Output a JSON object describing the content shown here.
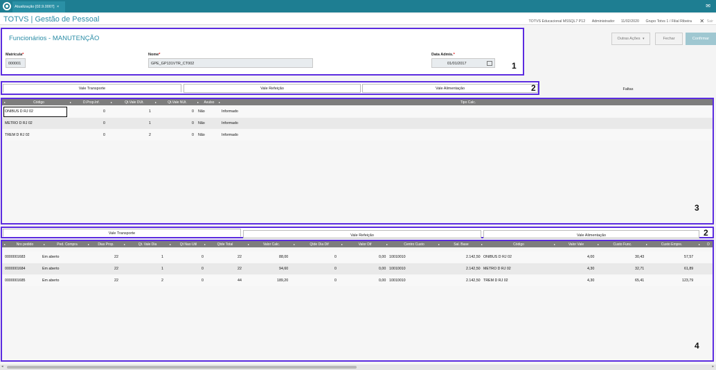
{
  "window": {
    "tab_label": "Atualização [02.9.0007]",
    "tab_close": "×",
    "app_title": "TOTVS | Gestão de Pessoal",
    "environment": "TOTVS Educacional MSSQL7 P12",
    "user": "Administrador",
    "date": "11/02/2020",
    "branch": "Grupo Totvs 1 / Filial Ribeira",
    "close_label": "✕",
    "extra": "Sair"
  },
  "form": {
    "title": "Funcionários - MANUTENÇÃO",
    "matricula_label": "Matrícula",
    "matricula_value": "000001",
    "nome_label": "Nome",
    "nome_value": "GPE_GP131VTR_CT002",
    "data_label": "Data Admis.",
    "data_value": "01/01/2017",
    "required_mark": "*"
  },
  "actions": {
    "outras": "Outras Ações",
    "fechar": "Fechar",
    "confirmar": "Confirmar"
  },
  "markers": {
    "m1": "1",
    "m2": "2",
    "m3": "3",
    "m2b": "2",
    "m4": "4"
  },
  "tabs_top": [
    "Vale Transporte",
    "Vale Refeição",
    "Vale Alimentação",
    "Faltas"
  ],
  "tabs_bottom": [
    "Vale Transporte",
    "Vale Refeição",
    "Vale Alimentação"
  ],
  "grid_top": {
    "headers": [
      "Código",
      "D.Prop.Inf.",
      "Qt.Vale DUt.",
      "Qt.Vale NUt.",
      "Avulso",
      "Tipo Calc."
    ],
    "rows": [
      [
        "ONIBUS D RJ 02",
        "0",
        "1",
        "0",
        "Não",
        "Informado"
      ],
      [
        "METRO D RJ 02",
        "0",
        "1",
        "0",
        "Não",
        "Informado"
      ],
      [
        "TREM D RJ 02",
        "0",
        "2",
        "0",
        "Não",
        "Informado"
      ]
    ]
  },
  "grid_bottom": {
    "headers": [
      "Nro pedido",
      "Ped. Compra",
      "Dias Prop.",
      "Qt. Vale Dia",
      "Qt Nao Util",
      "Qtde Total",
      "Valor Calc.",
      "Qtde Dia Dif",
      "Valor Dif",
      "Centro Custo",
      "Sal. Base",
      "Código",
      "Valor Vale",
      "Custo Func.",
      "Custo Empre.",
      "D"
    ],
    "rows": [
      [
        "0000001683",
        "Em aberto",
        "22",
        "1",
        "0",
        "22",
        "88,00",
        "0",
        "0,00",
        "10010010",
        "2.142,50",
        "ONIBUS D RJ 02",
        "4,00",
        "30,43",
        "57,57"
      ],
      [
        "0000001684",
        "Em aberto",
        "22",
        "1",
        "0",
        "22",
        "94,60",
        "0",
        "0,00",
        "10010010",
        "2.142,50",
        "METRO D RJ 02",
        "4,30",
        "32,71",
        "61,89"
      ],
      [
        "0000001685",
        "Em aberto",
        "22",
        "2",
        "0",
        "44",
        "189,20",
        "0",
        "0,00",
        "10010010",
        "2.142,50",
        "TREM D RJ 02",
        "4,30",
        "65,41",
        "123,79"
      ]
    ]
  },
  "colors": {
    "accent": "#2a8ca6",
    "annotation": "#5b2be0",
    "topbar": "#1e7e92"
  },
  "icons": {
    "app": "totvs-logo-icon",
    "calendar": "calendar-icon",
    "dropdown": "chevron-down-icon",
    "mail": "mail-icon"
  }
}
